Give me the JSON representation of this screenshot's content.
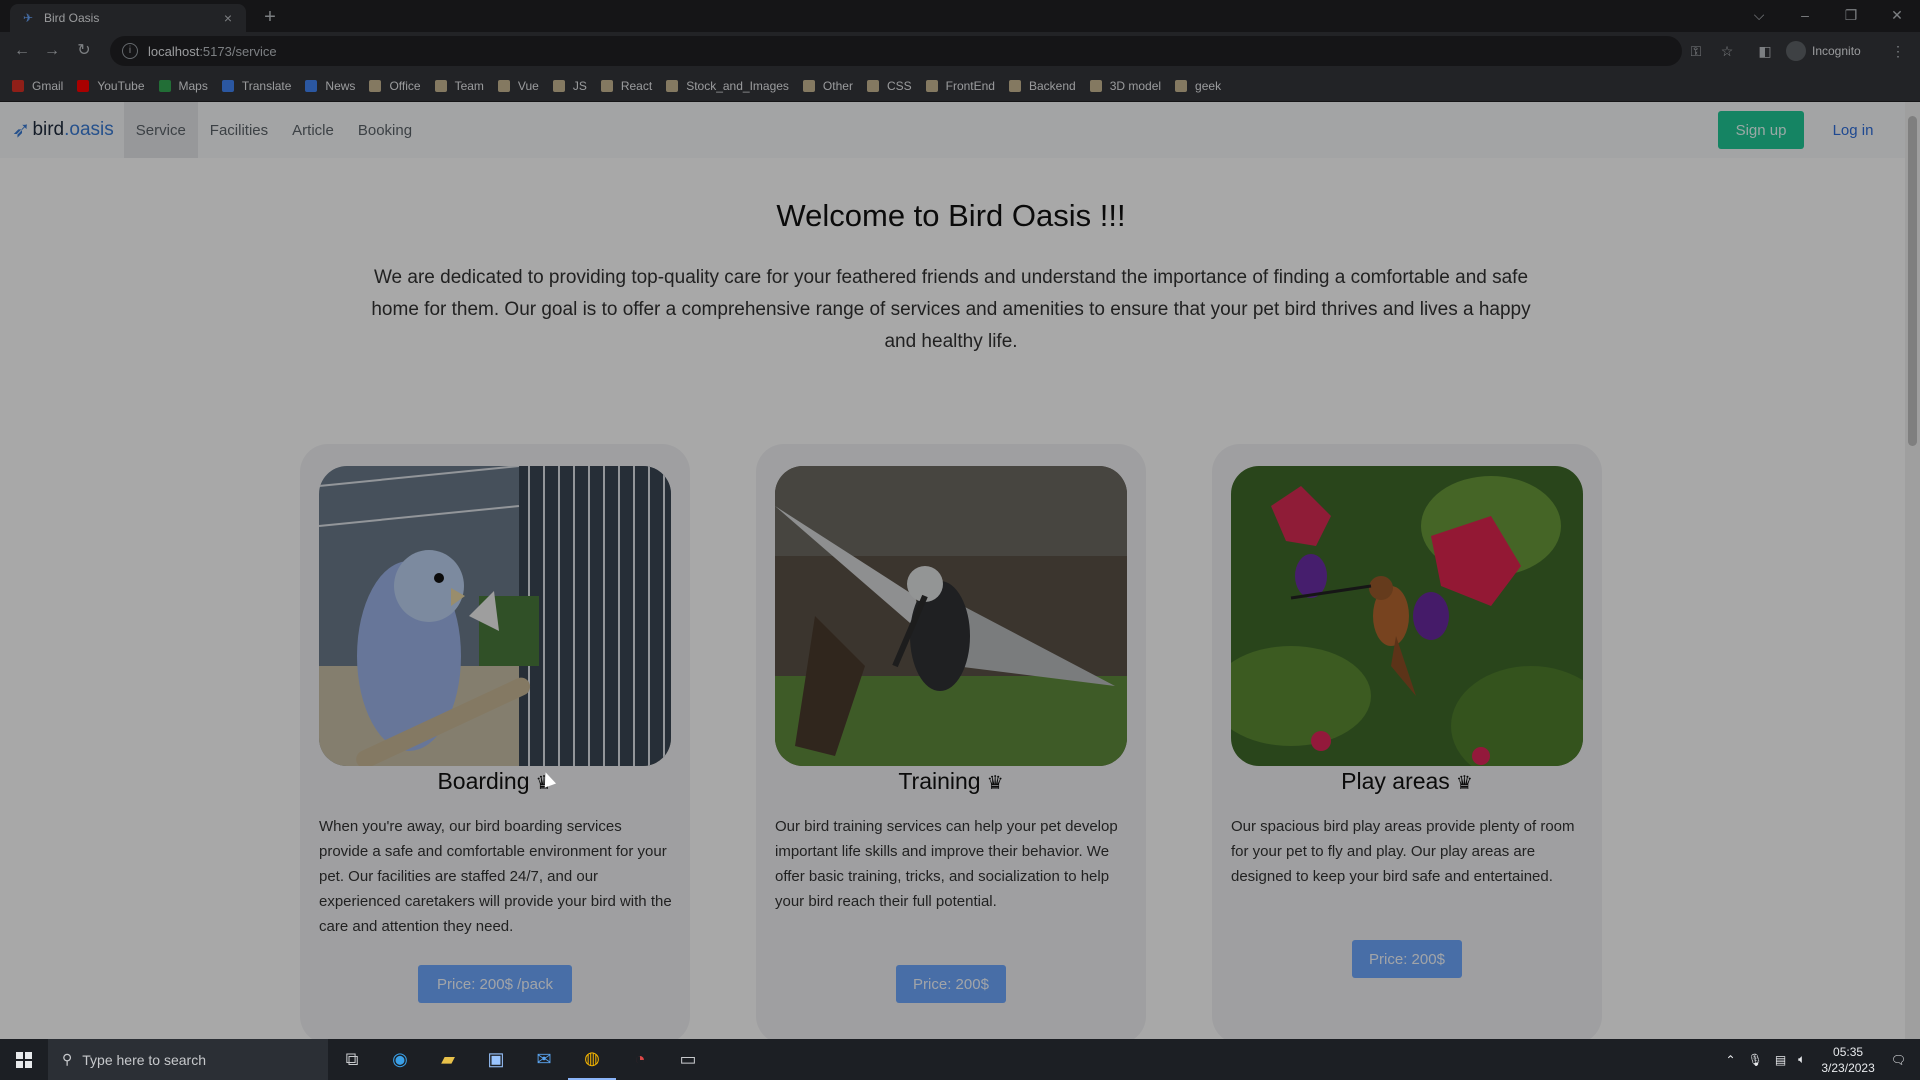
{
  "browser": {
    "tab_title": "Bird Oasis",
    "tab_close": "×",
    "new_tab": "+",
    "url_host": "localhost",
    "url_rest": ":5173/service",
    "profile_label": "Incognito",
    "window_controls": [
      "⌵",
      "–",
      "❐",
      "✕"
    ]
  },
  "bookmarks": [
    {
      "label": "Gmail",
      "icon": "gmail-icon",
      "color": "#d93025"
    },
    {
      "label": "YouTube",
      "icon": "youtube-icon",
      "color": "#ff0000"
    },
    {
      "label": "Maps",
      "icon": "maps-icon",
      "color": "#34a853"
    },
    {
      "label": "Translate",
      "icon": "translate-icon",
      "color": "#4285f4"
    },
    {
      "label": "News",
      "icon": "news-icon",
      "color": "#4285f4"
    },
    {
      "label": "Office",
      "icon": "folder-icon"
    },
    {
      "label": "Team",
      "icon": "folder-icon"
    },
    {
      "label": "Vue",
      "icon": "folder-icon"
    },
    {
      "label": "JS",
      "icon": "folder-icon"
    },
    {
      "label": "React",
      "icon": "folder-icon"
    },
    {
      "label": "Stock_and_Images",
      "icon": "folder-icon"
    },
    {
      "label": "Other",
      "icon": "folder-icon"
    },
    {
      "label": "CSS",
      "icon": "folder-icon"
    },
    {
      "label": "FrontEnd",
      "icon": "folder-icon"
    },
    {
      "label": "Backend",
      "icon": "folder-icon"
    },
    {
      "label": "3D model",
      "icon": "folder-icon"
    },
    {
      "label": "geek",
      "icon": "folder-icon"
    }
  ],
  "site": {
    "logo_bird": "bird",
    "logo_dot": ".",
    "logo_oasis": "oasis",
    "nav": [
      "Service",
      "Facilities",
      "Article",
      "Booking"
    ],
    "signup": "Sign up",
    "login": "Log in",
    "hero_title": "Welcome to Bird Oasis !!!",
    "hero_text": "We are dedicated to providing top-quality care for your feathered friends and understand the importance of finding a comfortable and safe home for them. Our goal is to offer a comprehensive range of services and amenities to ensure that your pet bird thrives and lives a happy and healthy life.",
    "crown": "♛",
    "cards": [
      {
        "title": "Boarding",
        "desc": "When you're away, our bird boarding services provide a safe and comfortable environment for your pet. Our facilities are staffed 24/7, and our experienced caretakers will provide your bird with the care and attention they need.",
        "price": "Price: 200$ /pack"
      },
      {
        "title": "Training",
        "desc": "Our bird training services can help your pet develop important life skills and improve their behavior. We offer basic training, tricks, and socialization to help your bird reach their full potential.",
        "price": "Price: 200$"
      },
      {
        "title": "Play areas",
        "desc": "Our spacious bird play areas provide plenty of room for your pet to fly and play. Our play areas are designed to keep your bird safe and entertained.",
        "price": "Price: 200$"
      }
    ]
  },
  "taskbar": {
    "search_placeholder": "Type here to search",
    "time": "05:35",
    "date": "3/23/2023"
  },
  "colors": {
    "signup": "#20c997",
    "price_button": "#6ea8fe",
    "link": "#2f6fdc"
  }
}
